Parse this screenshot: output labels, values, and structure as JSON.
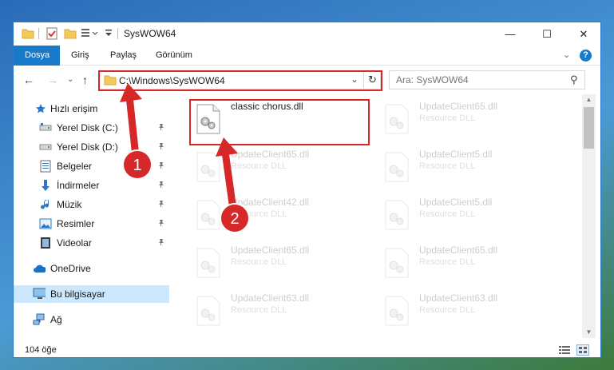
{
  "window": {
    "title": "SysWOW64",
    "controls": {
      "minimize": "—",
      "maximize": "☐",
      "close": "✕"
    }
  },
  "ribbon": {
    "tabs": [
      "Dosya",
      "Giriş",
      "Paylaş",
      "Görünüm"
    ],
    "expand": "⌄",
    "help": "?"
  },
  "navigation": {
    "back": "←",
    "forward": "→",
    "recent": "⌄",
    "up": "↑",
    "address": "C:\\Windows\\SysWOW64",
    "address_dropdown": "⌄",
    "refresh": "↻",
    "search_placeholder": "Ara: SysWOW64",
    "search_icon": "⚲"
  },
  "sidebar": {
    "items": [
      {
        "label": "Hızlı erişim",
        "icon": "star-icon",
        "pinned": false
      },
      {
        "label": "Yerel Disk (C:)",
        "icon": "drive-icon",
        "pinned": true
      },
      {
        "label": "Yerel Disk (D:)",
        "icon": "drive-icon",
        "pinned": true
      },
      {
        "label": "Belgeler",
        "icon": "documents-icon",
        "pinned": true
      },
      {
        "label": "İndirmeler",
        "icon": "download-icon",
        "pinned": true
      },
      {
        "label": "Müzik",
        "icon": "music-icon",
        "pinned": true
      },
      {
        "label": "Resimler",
        "icon": "pictures-icon",
        "pinned": true
      },
      {
        "label": "Videolar",
        "icon": "video-icon",
        "pinned": true
      },
      {
        "label": "OneDrive",
        "icon": "cloud-icon",
        "pinned": false
      },
      {
        "label": "Bu bilgisayar",
        "icon": "computer-icon",
        "pinned": false,
        "selected": true
      },
      {
        "label": "Ağ",
        "icon": "network-icon",
        "pinned": false
      }
    ],
    "pin_glyph": "📌"
  },
  "files": [
    {
      "name": "classic chorus.dll",
      "type": "",
      "highlighted": true
    },
    {
      "name": "UpdateClient65.dll",
      "type": "Resource DLL"
    },
    {
      "name": "UpdateClient65.dll",
      "type": "Resource DLL"
    },
    {
      "name": "UpdateClient5.dll",
      "type": "Resource DLL"
    },
    {
      "name": "UpdateClient42.dll",
      "type": "Resource DLL"
    },
    {
      "name": "UpdateClient5.dll",
      "type": "Resource DLL"
    },
    {
      "name": "UpdateClient65.dll",
      "type": "Resource DLL"
    },
    {
      "name": "UpdateClient65.dll",
      "type": "Resource DLL"
    },
    {
      "name": "UpdateClient63.dll",
      "type": "Resource DLL"
    },
    {
      "name": "UpdateClient63.dll",
      "type": "Resource DLL"
    }
  ],
  "annotations": {
    "step1": "1",
    "step2": "2",
    "color": "#d62828"
  },
  "status": {
    "count": "104 öğe"
  },
  "colors": {
    "accent": "#1979ca",
    "selection": "#cce8ff",
    "border": "#2b78c8"
  }
}
